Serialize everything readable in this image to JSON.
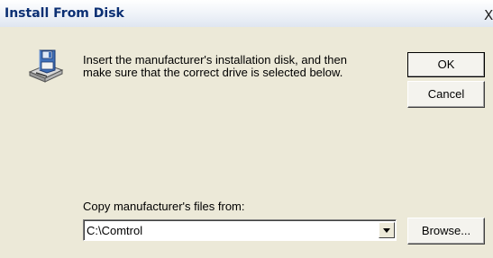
{
  "window": {
    "title": "Install From Disk",
    "close_glyph": "X"
  },
  "icon": "floppy-disk-drive-icon",
  "instructions": "Insert the manufacturer's installation disk, and then make sure that the correct drive is selected below.",
  "buttons": {
    "ok": "OK",
    "cancel": "Cancel",
    "browse": "Browse..."
  },
  "copy_from": {
    "label": "Copy manufacturer's files from:",
    "value": "C:\\Comtrol"
  }
}
